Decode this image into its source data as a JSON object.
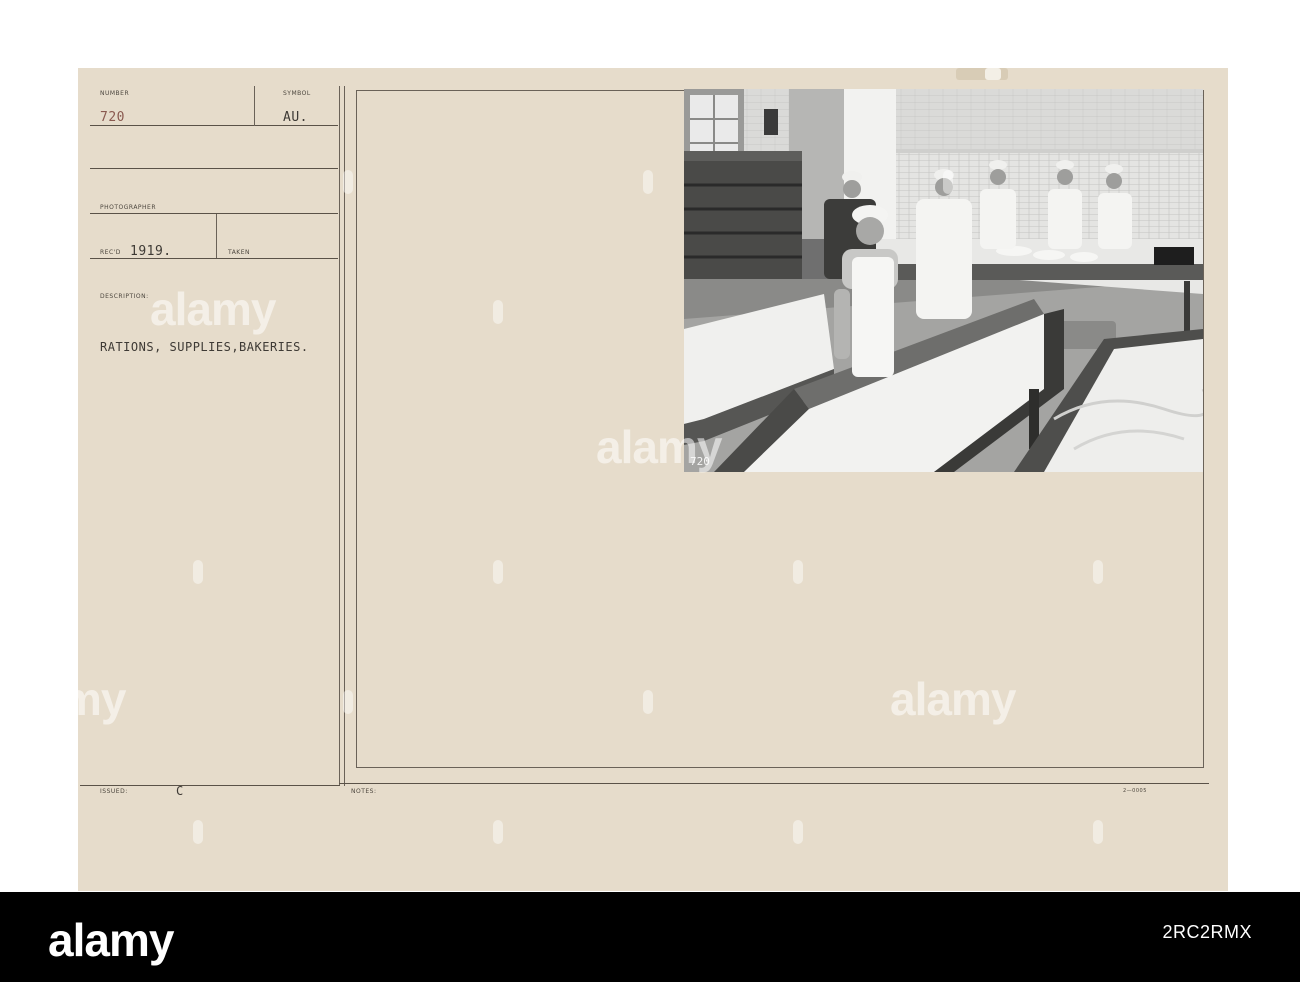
{
  "record": {
    "number_label": "NUMBER",
    "number_value": "720",
    "symbol_label": "SYMBOL",
    "symbol_value": "AU.",
    "photographer_label": "PHOTOGRAPHER",
    "recd_label": "REC'D",
    "recd_value": "1919.",
    "taken_label": "TAKEN",
    "description_label": "DESCRIPTION:",
    "description_value": "RATIONS, SUPPLIES,BAKERIES.",
    "issued_label": "ISSUED:",
    "issued_value": "C",
    "notes_label": "NOTES:",
    "form_code": "2—0005"
  },
  "photo": {
    "negative_number": "720"
  },
  "watermark": {
    "text": "alamy"
  },
  "footer": {
    "logo": "alamy",
    "image_id": "2RC2RMX"
  }
}
